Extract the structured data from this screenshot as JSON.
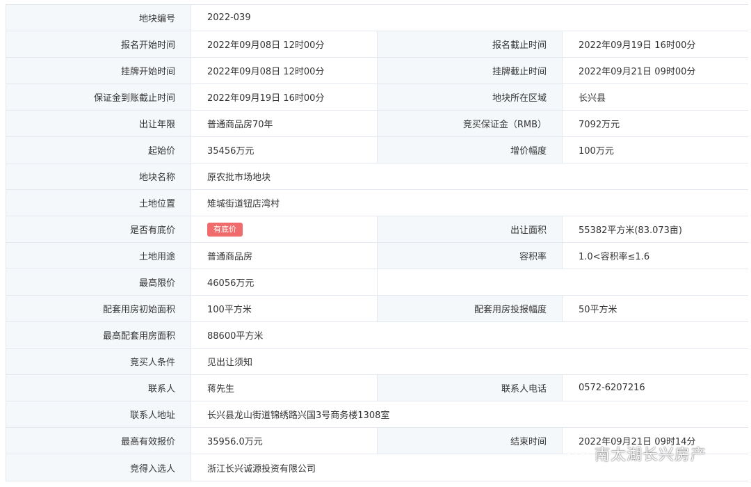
{
  "rows": [
    {
      "l1": "地块编号",
      "v1": "2022-039"
    },
    {
      "l1": "报名开始时间",
      "v1": "2022年09月08日 12时00分",
      "l2": "报名截止时间",
      "v2": "2022年09月19日 16时00分"
    },
    {
      "l1": "挂牌开始时间",
      "v1": "2022年09月08日 12时00分",
      "l2": "挂牌截止时间",
      "v2": "2022年09月21日 09时00分"
    },
    {
      "l1": "保证金到账截止时间",
      "v1": "2022年09月19日 16时00分",
      "l2": "地块所在区域",
      "v2": "长兴县"
    },
    {
      "l1": "出让年限",
      "v1": "普通商品房70年",
      "l2": "竞买保证金（RMB）",
      "v2": "7092万元"
    },
    {
      "l1": "起始价",
      "v1": "35456万元",
      "l2": "增价幅度",
      "v2": "100万元"
    },
    {
      "l1": "地块名称",
      "v1": "原农批市场地块"
    },
    {
      "l1": "土地位置",
      "v1": "雉城街道钮店湾村"
    },
    {
      "l1": "是否有底价",
      "v1": "有底价",
      "l2": "出让面积",
      "v2": "55382平方米(83.073亩)"
    },
    {
      "l1": "土地用途",
      "v1": "普通商品房",
      "l2": "容积率",
      "v2": "1.0<容积率≤1.6"
    },
    {
      "l1": "最高限价",
      "v1": "46056万元"
    },
    {
      "l1": "配套用房初始面积",
      "v1": "100平方米",
      "l2": "配套用房投报幅度",
      "v2": "50平方米"
    },
    {
      "l1": "最高配套用房面积",
      "v1": "88600平方米"
    },
    {
      "l1": "竞买人条件",
      "v1": "见出让须知"
    },
    {
      "l1": "联系人",
      "v1": "蒋先生",
      "l2": "联系人电话",
      "v2": "0572-6207216"
    },
    {
      "l1": "联系人地址",
      "v1": "长兴县龙山街道锦绣路兴国3号商务楼1308室"
    },
    {
      "l1": "最高有效报价",
      "v1": "35956.0万元",
      "l2": "结束时间",
      "v2": "2022年09月21日 09时14分"
    },
    {
      "l1": "竞得入选人",
      "v1": "浙江长兴诚源投资有限公司"
    }
  ],
  "watermark": {
    "text": "南太湖长兴房产",
    "icon": "wechat-icon"
  },
  "colors": {
    "label_bg": "#f5f8fb",
    "border": "#e4e9f0",
    "badge": "#f06b6b",
    "text": "#333333"
  }
}
